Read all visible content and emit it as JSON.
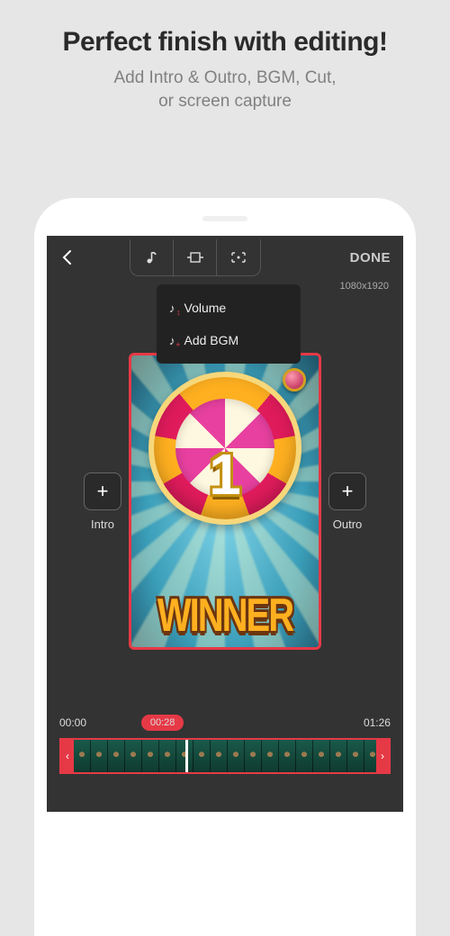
{
  "promo": {
    "title": "Perfect finish with editing!",
    "subtitle_l1": "Add Intro & Outro, BGM, Cut,",
    "subtitle_l2": "or screen capture"
  },
  "toolbar": {
    "done": "DONE"
  },
  "resolution": "1080x1920",
  "dropdown": {
    "volume": "Volume",
    "add_bgm": "Add BGM"
  },
  "slots": {
    "intro": "Intro",
    "outro": "Outro",
    "plus": "+"
  },
  "preview": {
    "rank": "1",
    "text": "WINNER"
  },
  "timeline": {
    "start": "00:00",
    "current": "00:28",
    "end": "01:26"
  }
}
